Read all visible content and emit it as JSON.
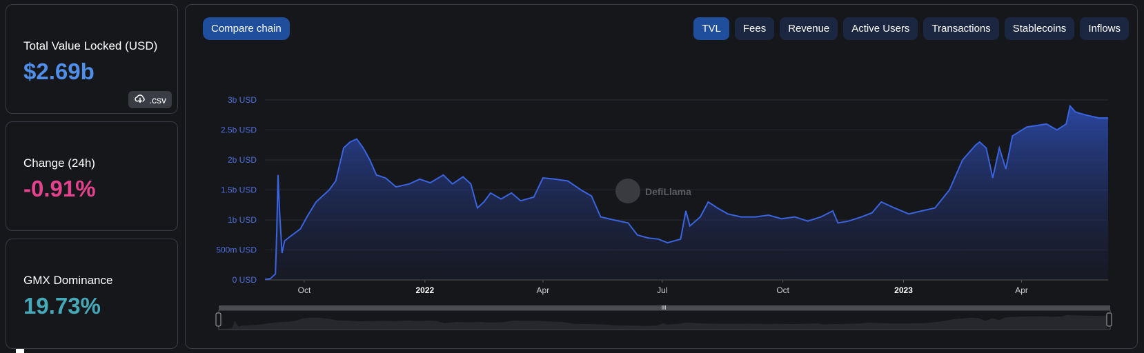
{
  "cards": {
    "tvl": {
      "label": "Total Value Locked (USD)",
      "value": "$2.69b",
      "csv_label": ".csv",
      "csv_icon": "cloud-download-icon",
      "color": "#4f8fea"
    },
    "change": {
      "label": "Change (24h)",
      "value": "-0.91%",
      "color": "#e6438f"
    },
    "dominance": {
      "label": "GMX Dominance",
      "value": "19.73%",
      "color": "#46a9b9"
    }
  },
  "toolbar": {
    "compare_label": "Compare chain",
    "tabs": [
      {
        "label": "TVL",
        "active": true
      },
      {
        "label": "Fees",
        "active": false
      },
      {
        "label": "Revenue",
        "active": false
      },
      {
        "label": "Active Users",
        "active": false
      },
      {
        "label": "Transactions",
        "active": false
      },
      {
        "label": "Stablecoins",
        "active": false
      },
      {
        "label": "Inflows",
        "active": false
      }
    ]
  },
  "watermark": "DefiLlama",
  "colors": {
    "line": "#3a64e0",
    "axis_text": "#4f6fe0",
    "accent": "#1e4e9c"
  },
  "chart_data": {
    "type": "area",
    "series": [
      {
        "points": [
          [
            "2021-09-01",
            0.01
          ],
          [
            "2021-09-05",
            0.02
          ],
          [
            "2021-09-09",
            0.1
          ],
          [
            "2021-09-10",
            0.8
          ],
          [
            "2021-09-11",
            1.75
          ],
          [
            "2021-09-12",
            1.2
          ],
          [
            "2021-09-14",
            0.45
          ],
          [
            "2021-09-16",
            0.65
          ],
          [
            "2021-09-20",
            0.72
          ],
          [
            "2021-09-28",
            0.85
          ],
          [
            "2021-10-03",
            1.05
          ],
          [
            "2021-10-10",
            1.3
          ],
          [
            "2021-10-20",
            1.5
          ],
          [
            "2021-10-25",
            1.65
          ],
          [
            "2021-10-31",
            2.2
          ],
          [
            "2021-11-05",
            2.3
          ],
          [
            "2021-11-10",
            2.35
          ],
          [
            "2021-11-15",
            2.2
          ],
          [
            "2021-11-20",
            2.0
          ],
          [
            "2021-11-25",
            1.75
          ],
          [
            "2021-12-02",
            1.7
          ],
          [
            "2021-12-10",
            1.55
          ],
          [
            "2021-12-20",
            1.6
          ],
          [
            "2021-12-28",
            1.68
          ],
          [
            "2022-01-05",
            1.62
          ],
          [
            "2022-01-15",
            1.75
          ],
          [
            "2022-01-22",
            1.6
          ],
          [
            "2022-01-30",
            1.72
          ],
          [
            "2022-02-05",
            1.6
          ],
          [
            "2022-02-10",
            1.2
          ],
          [
            "2022-02-15",
            1.3
          ],
          [
            "2022-02-20",
            1.45
          ],
          [
            "2022-02-28",
            1.35
          ],
          [
            "2022-03-08",
            1.45
          ],
          [
            "2022-03-15",
            1.32
          ],
          [
            "2022-03-25",
            1.38
          ],
          [
            "2022-04-01",
            1.7
          ],
          [
            "2022-04-10",
            1.68
          ],
          [
            "2022-04-20",
            1.65
          ],
          [
            "2022-04-30",
            1.5
          ],
          [
            "2022-05-08",
            1.4
          ],
          [
            "2022-05-15",
            1.05
          ],
          [
            "2022-05-25",
            1.0
          ],
          [
            "2022-06-05",
            0.95
          ],
          [
            "2022-06-12",
            0.75
          ],
          [
            "2022-06-20",
            0.7
          ],
          [
            "2022-06-28",
            0.68
          ],
          [
            "2022-07-05",
            0.62
          ],
          [
            "2022-07-15",
            0.68
          ],
          [
            "2022-07-19",
            1.15
          ],
          [
            "2022-07-22",
            0.9
          ],
          [
            "2022-07-30",
            1.05
          ],
          [
            "2022-08-05",
            1.3
          ],
          [
            "2022-08-12",
            1.2
          ],
          [
            "2022-08-20",
            1.1
          ],
          [
            "2022-08-30",
            1.05
          ],
          [
            "2022-09-10",
            1.05
          ],
          [
            "2022-09-20",
            1.08
          ],
          [
            "2022-09-30",
            1.02
          ],
          [
            "2022-10-10",
            1.05
          ],
          [
            "2022-10-20",
            0.98
          ],
          [
            "2022-10-30",
            1.05
          ],
          [
            "2022-11-08",
            1.15
          ],
          [
            "2022-11-12",
            0.95
          ],
          [
            "2022-11-20",
            0.98
          ],
          [
            "2022-11-30",
            1.05
          ],
          [
            "2022-12-08",
            1.12
          ],
          [
            "2022-12-15",
            1.3
          ],
          [
            "2022-12-25",
            1.2
          ],
          [
            "2023-01-05",
            1.1
          ],
          [
            "2023-01-15",
            1.15
          ],
          [
            "2023-01-25",
            1.2
          ],
          [
            "2023-02-05",
            1.5
          ],
          [
            "2023-02-15",
            2.0
          ],
          [
            "2023-02-25",
            2.25
          ],
          [
            "2023-02-28",
            2.3
          ],
          [
            "2023-03-05",
            2.2
          ],
          [
            "2023-03-10",
            1.7
          ],
          [
            "2023-03-15",
            2.2
          ],
          [
            "2023-03-20",
            1.85
          ],
          [
            "2023-03-25",
            2.4
          ],
          [
            "2023-04-05",
            2.55
          ],
          [
            "2023-04-20",
            2.6
          ],
          [
            "2023-04-28",
            2.5
          ],
          [
            "2023-05-05",
            2.6
          ],
          [
            "2023-05-08",
            2.9
          ],
          [
            "2023-05-12",
            2.8
          ],
          [
            "2023-05-20",
            2.75
          ],
          [
            "2023-05-30",
            2.7
          ],
          [
            "2023-06-06",
            2.7
          ]
        ]
      }
    ],
    "x_ticks": [
      {
        "date": "2021-10-01",
        "label": "Oct",
        "bold": false
      },
      {
        "date": "2022-01-01",
        "label": "2022",
        "bold": true
      },
      {
        "date": "2022-04-01",
        "label": "Apr",
        "bold": false
      },
      {
        "date": "2022-07-01",
        "label": "Jul",
        "bold": false
      },
      {
        "date": "2022-10-01",
        "label": "Oct",
        "bold": false
      },
      {
        "date": "2023-01-01",
        "label": "2023",
        "bold": true
      },
      {
        "date": "2023-04-01",
        "label": "Apr",
        "bold": false
      }
    ],
    "y_ticks": [
      {
        "value": 0,
        "label": "0 USD"
      },
      {
        "value": 0.5,
        "label": "500m USD"
      },
      {
        "value": 1.0,
        "label": "1b USD"
      },
      {
        "value": 1.5,
        "label": "1.5b USD"
      },
      {
        "value": 2.0,
        "label": "2b USD"
      },
      {
        "value": 2.5,
        "label": "2.5b USD"
      },
      {
        "value": 3.0,
        "label": "3b USD"
      }
    ],
    "xlim": [
      "2021-09-01",
      "2023-06-06"
    ],
    "ylim": [
      0,
      3.0
    ],
    "y_unit": "billion USD",
    "grid": true
  }
}
